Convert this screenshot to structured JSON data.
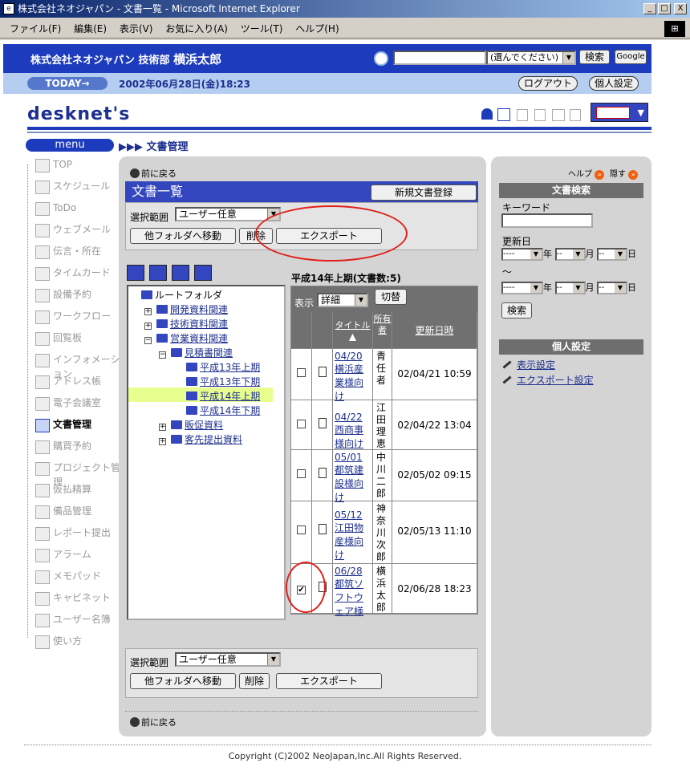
{
  "window": {
    "title": "株式会社ネオジャパン - 文書一覧 - Microsoft Internet Explorer",
    "min": "_",
    "max": "□",
    "close": "X"
  },
  "menubar": [
    "ファイル(F)",
    "編集(E)",
    "表示(V)",
    "お気に入り(A)",
    "ツール(T)",
    "ヘルプ(H)"
  ],
  "header": {
    "company": "株式会社ネオジャパン",
    "dept": "技術部",
    "user": "横浜太郎",
    "select_placeholder": "(選んでください)",
    "search_btn": "検索",
    "google_btn": "Google"
  },
  "datebar": {
    "today": "TODAY→",
    "date": "2002年06月28日(金)18:23",
    "logout": "ログアウト",
    "settings": "個人設定"
  },
  "logo": "desknet's",
  "nav": {
    "menu": "menu",
    "crumb": "▶▶▶ 文書管理"
  },
  "sidebar": [
    "TOP",
    "スケジュール",
    "ToDo",
    "ウェブメール",
    "伝言・所在",
    "タイムカード",
    "設備予約",
    "ワークフロー",
    "回覧板",
    "インフォメーション",
    "アドレス帳",
    "電子会議室",
    "文書管理",
    "購買予約",
    "プロジェクト管理",
    "仮払精算",
    "備品管理",
    "レポート提出",
    "アラーム",
    "メモパッド",
    "キャビネット",
    "ユーザー名簿",
    "使い方"
  ],
  "main": {
    "back": "前に戻る",
    "title": "文書一覧",
    "new_btn": "新規文書登録",
    "scope_label": "選択範囲",
    "scope_value": "ユーザー任意",
    "move_btn": "他フォルダへ移動",
    "delete_btn": "削除",
    "export_btn": "エクスポート",
    "tree": [
      {
        "label": "ルートフォルダ"
      },
      {
        "label": "開発資料関連",
        "pm": "+"
      },
      {
        "label": "技術資料関連",
        "pm": "+"
      },
      {
        "label": "営業資料関連",
        "pm": "−"
      },
      {
        "label": "見積書関連",
        "pm": "−"
      },
      {
        "label": "平成13年上期"
      },
      {
        "label": "平成13年下期"
      },
      {
        "label": "平成14年上期"
      },
      {
        "label": "平成14年下期"
      },
      {
        "label": "販促資料",
        "pm": "+"
      },
      {
        "label": "客先提出資料",
        "pm": "+"
      }
    ],
    "list_title": "平成14年上期(文書数:5)",
    "view_label": "表示",
    "view_value": "詳細",
    "switch_btn": "切替",
    "col_title": "タイトル▲",
    "col_owner": "所有者",
    "col_updated": "更新日時",
    "rows": [
      {
        "title": "04/20横浜産業様向け",
        "owner": "青任者",
        "updated": "02/04/21 10:59",
        "checked": ""
      },
      {
        "title": "04/22西商事様向け",
        "owner": "江田理恵",
        "updated": "02/04/22 13:04",
        "checked": ""
      },
      {
        "title": "05/01都筑建設様向け",
        "owner": "中川二郎",
        "updated": "02/05/02 09:15",
        "checked": ""
      },
      {
        "title": "05/12江田物産様向け",
        "owner": "神奈川次郎",
        "updated": "02/05/13 11:10",
        "checked": ""
      },
      {
        "title": "06/28都筑ソフトウェア様",
        "owner": "横浜太郎",
        "updated": "02/06/28 18:23",
        "checked": "✔"
      }
    ]
  },
  "right": {
    "help": "ヘルプ",
    "hide": "隠す",
    "search_head": "文書検索",
    "keyword": "キーワード",
    "updated": "更新日",
    "dash": "----",
    "dd": "--",
    "year": "年",
    "month": "月",
    "day": "日",
    "tilde": "〜",
    "search_btn": "検索",
    "personal_head": "個人設定",
    "view_setting": "表示設定",
    "export_setting": "エクスポート設定"
  },
  "footer": "Copyright (C)2002 NeoJapan,Inc.All Rights Reserved."
}
